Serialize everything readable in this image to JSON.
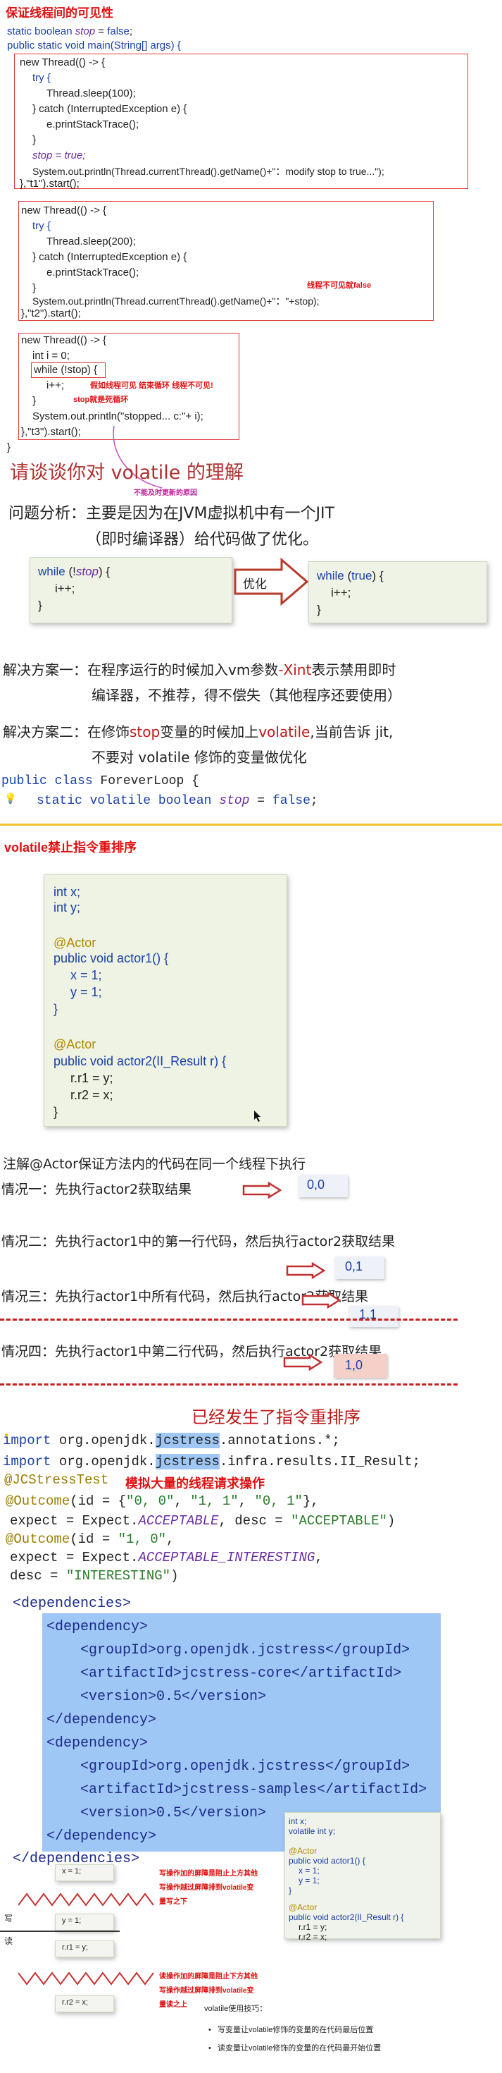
{
  "sec1": {
    "title": "保证线程间的可见性",
    "l1": "static boolean stop = false;",
    "l2": "public static void main(String[] args) {",
    "t1": [
      "new Thread(() -> {",
      "try {",
      "Thread.sleep(100);",
      "} catch (InterruptedException e) {",
      "e.printStackTrace();",
      "}",
      "stop = true;",
      "System.out.println(Thread.currentThread().getName()+\"：modify stop to true...\");",
      "},\"t1\").start();"
    ],
    "t2": [
      "new Thread(() -> {",
      "try {",
      "Thread.sleep(200);",
      "} catch (InterruptedException e) {",
      "e.printStackTrace();",
      "}",
      "System.out.println(Thread.currentThread().getName()+\"：\"+stop);",
      "},\"t2\").start();"
    ],
    "t3": [
      "new Thread(() -> {",
      "int i = 0;",
      "while (!stop) {",
      "i++;",
      "}",
      "System.out.println(\"stopped... c:\"+ i);",
      "},\"t3\").start();",
      "}"
    ],
    "note_t2": "线程不可见就false",
    "note_t3a": "假如线程可见 结束循环 线程不可见!",
    "note_t3b": "stop就是死循环",
    "note_t3c": "不能及时更新的原因"
  },
  "sec2": {
    "heading": "请谈谈你对 volatile 的理解",
    "analysis1": "问题分析：主要是因为在JVM虚拟机中有一个JIT",
    "analysis2": "（即时编译器）给代码做了优化。",
    "box_left": [
      "while (!stop) {",
      "i++;",
      "}"
    ],
    "optimize": "优化",
    "box_right": [
      "while (true) {",
      "i++;",
      "}"
    ],
    "sol1a": "解决方案一：在程序运行的时候加入vm参数-Xint表示禁用即时",
    "sol1b": "编译器，不推荐，得不偿失（其他程序还要使用）",
    "sol2a": "解决方案二：在修饰stop变量的时候加上volatile,当前告诉 jit,",
    "sol2b": "不要对 volatile 修饰的变量做优化",
    "code1": "public class ForeverLoop {",
    "code2": "static volatile boolean stop = false;"
  },
  "sec3": {
    "title": "volatile禁止指令重排序",
    "card": [
      "int x;",
      "int y;",
      "",
      "@Actor",
      "public void actor1() {",
      "x = 1;",
      "y = 1;",
      "}",
      "",
      "@Actor",
      "public void actor2(II_Result r) {",
      "r.r1 = y;",
      "r.r2 = x;",
      "}"
    ],
    "note": "注解@Actor保证方法内的代码在同一个线程下执行",
    "case1": "情况一：先执行actor2获取结果",
    "r1": "0,0",
    "case2": "情况二：先执行actor1中的第一行代码，然后执行actor2获取结果",
    "r2": "0,1",
    "case3": "情况三：先执行actor1中所有代码，然后执行actor2获取结果",
    "r3": "1,1",
    "case4": "情况四：先执行actor1中第二行代码，然后执行actor2获取结果",
    "r4": "1,0",
    "reorder": "已经发生了指令重排序"
  },
  "sec4": {
    "imp1": "import org.openjdk.jcstress.annotations.*;",
    "imp2": "import org.openjdk.jcstress.infra.results.II_Result;",
    "jct": "@JCStressTest",
    "jct_note": "模拟大量的线程请求操作",
    "o1": "@Outcome(id = {\"0, 0\", \"1, 1\", \"0, 1\"},",
    "o2": "expect = Expect.ACCEPTABLE, desc = \"ACCEPTABLE\")",
    "o3": "@Outcome(id = \"1, 0\",",
    "o4": "expect = Expect.ACCEPTABLE_INTERESTING,",
    "o5": "desc = \"INTERESTING\")"
  },
  "sec5": {
    "lines": [
      "<dependencies>",
      "<dependency>",
      "<groupId>org.openjdk.jcstress</groupId>",
      "<artifactId>jcstress-core</artifactId>",
      "<version>0.5</version>",
      "</dependency>",
      "<dependency>",
      "<groupId>org.openjdk.jcstress</groupId>",
      "<artifactId>jcstress-samples</artifactId>",
      "<version>0.5</version>",
      "</dependency>",
      "</dependencies>"
    ]
  },
  "sec6": {
    "bx1": "x = 1;",
    "by1": "y = 1;",
    "br1": "r.r1 = y;",
    "br2": "r.r2 = x;",
    "write": "写",
    "read": "读",
    "wnote1": "写操作加的屏障是阻止上方其他",
    "wnote2": "写操作越过屏障排到volatile变",
    "wnote3": "量写之下",
    "rnote1": "读操作加的屏障是阻止下方其他",
    "rnote2": "写操作越过屏障排到volatile变",
    "rnote3": "量读之上",
    "tip": "volatile使用技巧：",
    "tip1": "写变量让volatile修饰的变量的在代码最后位置",
    "tip2": "读变量让volatile修饰的变量的在代码最开始位置",
    "card": [
      "int x;",
      "volatile int y;",
      "",
      "@Actor",
      "public void actor1() {",
      "x = 1;",
      "y = 1;",
      "}",
      "",
      "@Actor",
      "public void actor2(II_Result r) {",
      "r.r1 = y;",
      "r.r2 = x;",
      "}"
    ]
  }
}
